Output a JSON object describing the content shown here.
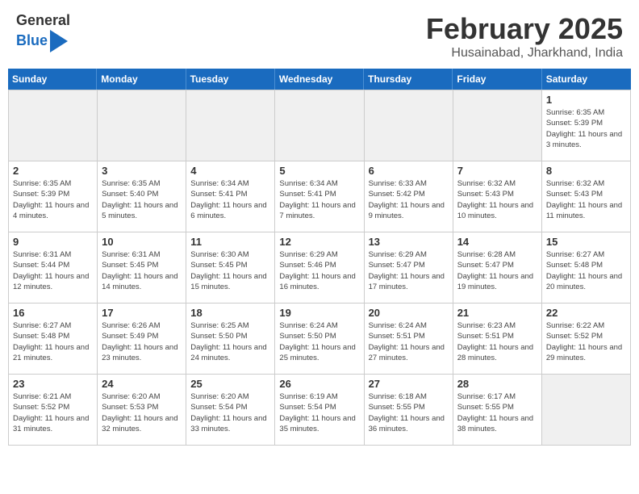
{
  "header": {
    "logo_general": "General",
    "logo_blue": "Blue",
    "month_year": "February 2025",
    "location": "Husainabad, Jharkhand, India"
  },
  "weekdays": [
    "Sunday",
    "Monday",
    "Tuesday",
    "Wednesday",
    "Thursday",
    "Friday",
    "Saturday"
  ],
  "weeks": [
    [
      {
        "day": "",
        "empty": true
      },
      {
        "day": "",
        "empty": true
      },
      {
        "day": "",
        "empty": true
      },
      {
        "day": "",
        "empty": true
      },
      {
        "day": "",
        "empty": true
      },
      {
        "day": "",
        "empty": true
      },
      {
        "day": "1",
        "sunrise": "6:35 AM",
        "sunset": "5:39 PM",
        "daylight": "11 hours and 3 minutes."
      }
    ],
    [
      {
        "day": "2",
        "sunrise": "6:35 AM",
        "sunset": "5:39 PM",
        "daylight": "11 hours and 4 minutes."
      },
      {
        "day": "3",
        "sunrise": "6:35 AM",
        "sunset": "5:40 PM",
        "daylight": "11 hours and 5 minutes."
      },
      {
        "day": "4",
        "sunrise": "6:34 AM",
        "sunset": "5:41 PM",
        "daylight": "11 hours and 6 minutes."
      },
      {
        "day": "5",
        "sunrise": "6:34 AM",
        "sunset": "5:41 PM",
        "daylight": "11 hours and 7 minutes."
      },
      {
        "day": "6",
        "sunrise": "6:33 AM",
        "sunset": "5:42 PM",
        "daylight": "11 hours and 9 minutes."
      },
      {
        "day": "7",
        "sunrise": "6:32 AM",
        "sunset": "5:43 PM",
        "daylight": "11 hours and 10 minutes."
      },
      {
        "day": "8",
        "sunrise": "6:32 AM",
        "sunset": "5:43 PM",
        "daylight": "11 hours and 11 minutes."
      }
    ],
    [
      {
        "day": "9",
        "sunrise": "6:31 AM",
        "sunset": "5:44 PM",
        "daylight": "11 hours and 12 minutes."
      },
      {
        "day": "10",
        "sunrise": "6:31 AM",
        "sunset": "5:45 PM",
        "daylight": "11 hours and 14 minutes."
      },
      {
        "day": "11",
        "sunrise": "6:30 AM",
        "sunset": "5:45 PM",
        "daylight": "11 hours and 15 minutes."
      },
      {
        "day": "12",
        "sunrise": "6:29 AM",
        "sunset": "5:46 PM",
        "daylight": "11 hours and 16 minutes."
      },
      {
        "day": "13",
        "sunrise": "6:29 AM",
        "sunset": "5:47 PM",
        "daylight": "11 hours and 17 minutes."
      },
      {
        "day": "14",
        "sunrise": "6:28 AM",
        "sunset": "5:47 PM",
        "daylight": "11 hours and 19 minutes."
      },
      {
        "day": "15",
        "sunrise": "6:27 AM",
        "sunset": "5:48 PM",
        "daylight": "11 hours and 20 minutes."
      }
    ],
    [
      {
        "day": "16",
        "sunrise": "6:27 AM",
        "sunset": "5:48 PM",
        "daylight": "11 hours and 21 minutes."
      },
      {
        "day": "17",
        "sunrise": "6:26 AM",
        "sunset": "5:49 PM",
        "daylight": "11 hours and 23 minutes."
      },
      {
        "day": "18",
        "sunrise": "6:25 AM",
        "sunset": "5:50 PM",
        "daylight": "11 hours and 24 minutes."
      },
      {
        "day": "19",
        "sunrise": "6:24 AM",
        "sunset": "5:50 PM",
        "daylight": "11 hours and 25 minutes."
      },
      {
        "day": "20",
        "sunrise": "6:24 AM",
        "sunset": "5:51 PM",
        "daylight": "11 hours and 27 minutes."
      },
      {
        "day": "21",
        "sunrise": "6:23 AM",
        "sunset": "5:51 PM",
        "daylight": "11 hours and 28 minutes."
      },
      {
        "day": "22",
        "sunrise": "6:22 AM",
        "sunset": "5:52 PM",
        "daylight": "11 hours and 29 minutes."
      }
    ],
    [
      {
        "day": "23",
        "sunrise": "6:21 AM",
        "sunset": "5:52 PM",
        "daylight": "11 hours and 31 minutes."
      },
      {
        "day": "24",
        "sunrise": "6:20 AM",
        "sunset": "5:53 PM",
        "daylight": "11 hours and 32 minutes."
      },
      {
        "day": "25",
        "sunrise": "6:20 AM",
        "sunset": "5:54 PM",
        "daylight": "11 hours and 33 minutes."
      },
      {
        "day": "26",
        "sunrise": "6:19 AM",
        "sunset": "5:54 PM",
        "daylight": "11 hours and 35 minutes."
      },
      {
        "day": "27",
        "sunrise": "6:18 AM",
        "sunset": "5:55 PM",
        "daylight": "11 hours and 36 minutes."
      },
      {
        "day": "28",
        "sunrise": "6:17 AM",
        "sunset": "5:55 PM",
        "daylight": "11 hours and 38 minutes."
      },
      {
        "day": "",
        "empty": true
      }
    ]
  ]
}
